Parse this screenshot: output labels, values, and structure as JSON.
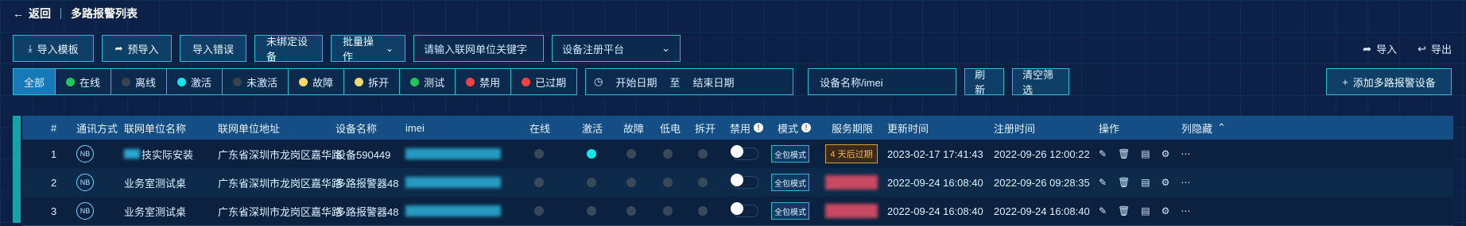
{
  "header": {
    "back_label": "返回",
    "title": "多路报警列表"
  },
  "toolbar": {
    "import_template": "导入模板",
    "pre_import": "预导入",
    "import_errors": "导入错误",
    "unbound_devices": "未绑定设备",
    "bulk_ops": "批量操作",
    "unit_search_placeholder": "请输入联网单位关键字",
    "platform_select": "设备注册平台",
    "import": "导入",
    "export": "导出"
  },
  "filters": {
    "items": [
      {
        "label": "全部",
        "color": ""
      },
      {
        "label": "在线",
        "color": "#22c55e"
      },
      {
        "label": "离线",
        "color": "#3a4352"
      },
      {
        "label": "激活",
        "color": "#12e6e6"
      },
      {
        "label": "未激活",
        "color": "#3a4352"
      },
      {
        "label": "故障",
        "color": "#f1d96a"
      },
      {
        "label": "拆开",
        "color": "#f1d96a"
      },
      {
        "label": "测试",
        "color": "#22c55e"
      },
      {
        "label": "禁用",
        "color": "#ef4444"
      },
      {
        "label": "已过期",
        "color": "#ef4444"
      }
    ],
    "date_start": "开始日期",
    "date_to": "至",
    "date_end": "结束日期",
    "device_placeholder": "设备名称/imei",
    "refresh": "刷新",
    "clear": "清空筛选",
    "add_device": "添加多路报警设备"
  },
  "table": {
    "headers": [
      "#",
      "通讯方式",
      "联网单位名称",
      "联网单位地址",
      "设备名称",
      "imei",
      "在线",
      "激活",
      "故障",
      "低电",
      "拆开",
      "禁用",
      "模式",
      "服务期限",
      "更新时间",
      "注册时间",
      "操作",
      "列隐藏"
    ],
    "rows": [
      {
        "index": "1",
        "comm": "NB",
        "unit": "技实际安装",
        "address": "广东省深圳市龙岗区嘉华路",
        "device": "设备590449",
        "activated": true,
        "mode": "全包模式",
        "service": "4 天后过期",
        "updated": "2023-02-17 17:41:43",
        "registered": "2022-09-26 12:00:22"
      },
      {
        "index": "2",
        "comm": "NB",
        "unit": "业务室测试桌",
        "address": "广东省深圳市龙岗区嘉华路",
        "device": "多路报警器48",
        "activated": false,
        "mode": "全包模式",
        "service": "",
        "updated": "2022-09-24 16:08:40",
        "registered": "2022-09-26 09:28:35"
      },
      {
        "index": "3",
        "comm": "NB",
        "unit": "业务室测试桌",
        "address": "广东省深圳市龙岗区嘉华路",
        "device": "多路报警器48",
        "activated": false,
        "mode": "全包模式",
        "service": "",
        "updated": "2022-09-24 16:08:40",
        "registered": "2022-09-24 16:08:40"
      }
    ]
  }
}
